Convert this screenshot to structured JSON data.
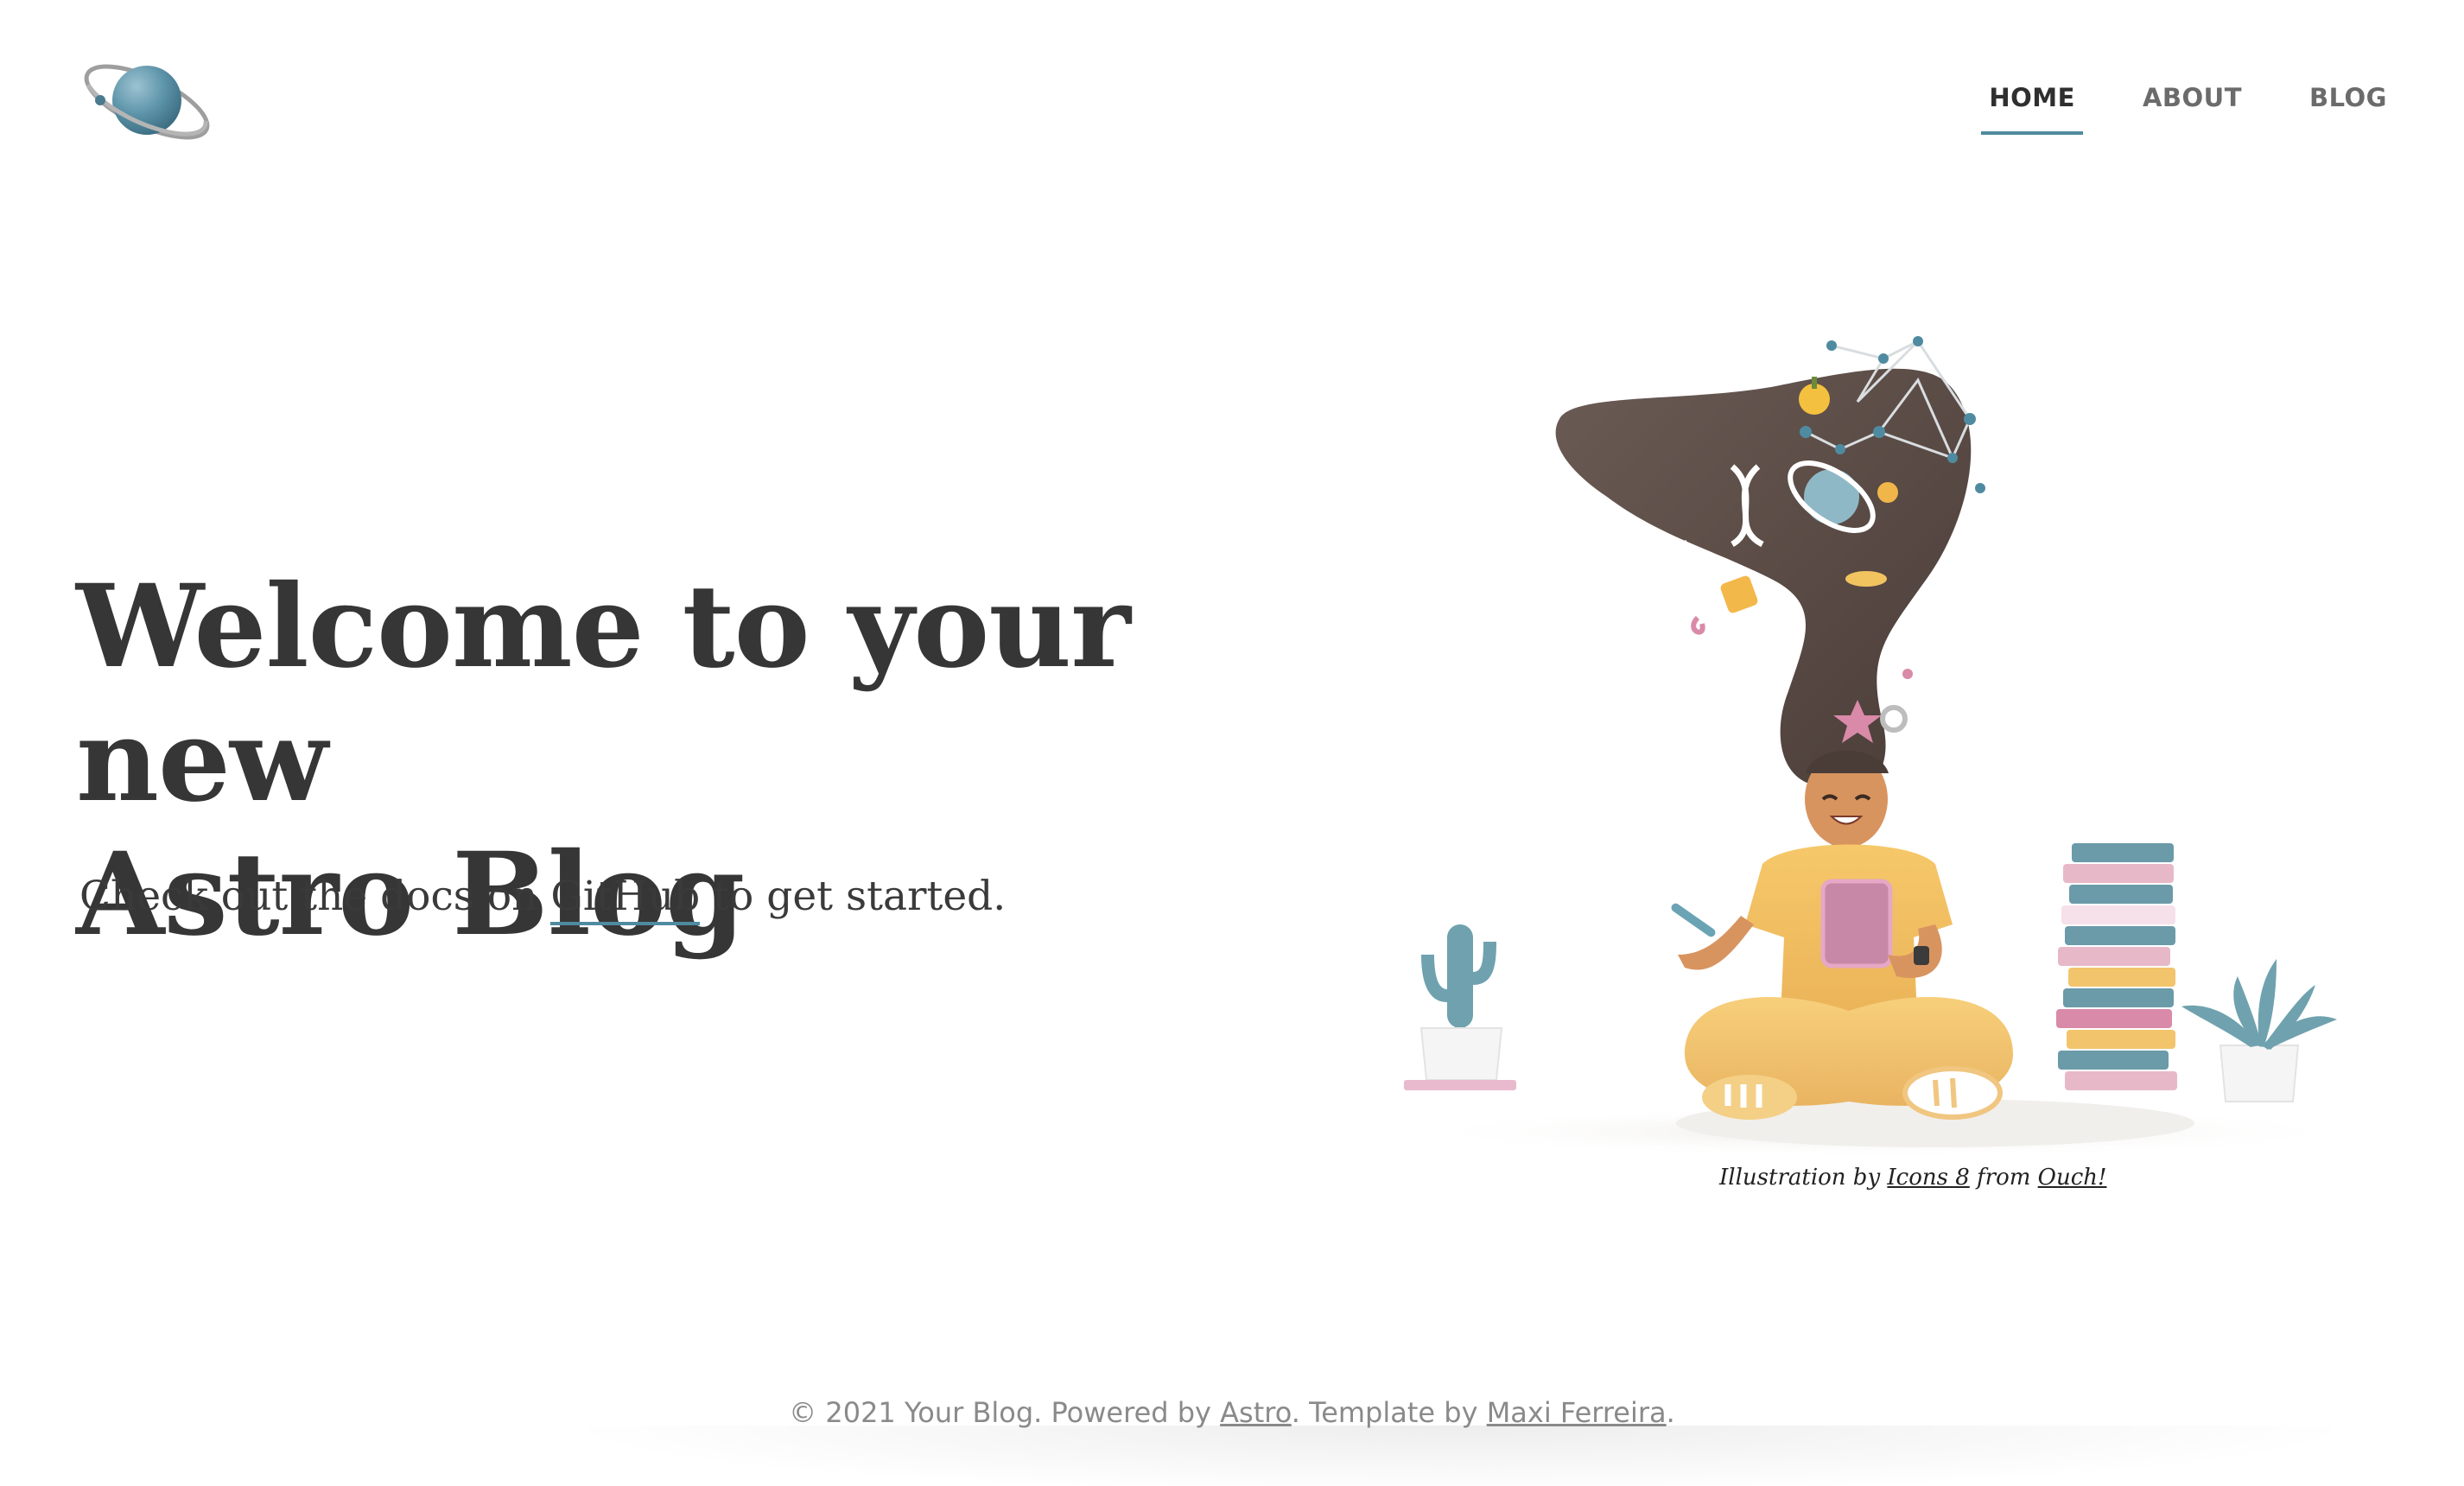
{
  "header": {
    "logo_icon": "planet-logo-icon",
    "nav": [
      {
        "label": "HOME",
        "active": true
      },
      {
        "label": "ABOUT",
        "active": false
      },
      {
        "label": "BLOG",
        "active": false
      }
    ]
  },
  "hero": {
    "title_line1": "Welcome to your new",
    "title_line2": "Astro Blog",
    "subtitle_before": "Check out the docs on ",
    "subtitle_link": "GitHub",
    "subtitle_after": " to get started."
  },
  "illustration": {
    "icon": "girl-meditating-illustration",
    "caption_prefix": "Illustration by ",
    "caption_link1": "Icons 8",
    "caption_middle": " from ",
    "caption_link2": "Ouch!"
  },
  "footer": {
    "prefix": "© 2021 Your Blog. Powered by ",
    "link1": "Astro",
    "middle": ". Template by ",
    "link2": "Maxi Ferreira",
    "suffix": "."
  },
  "colors": {
    "accent": "#4f8ba0",
    "text_dark": "#363636",
    "nav_inactive": "#6b6b6b",
    "footer_text": "#8a8a8a"
  }
}
